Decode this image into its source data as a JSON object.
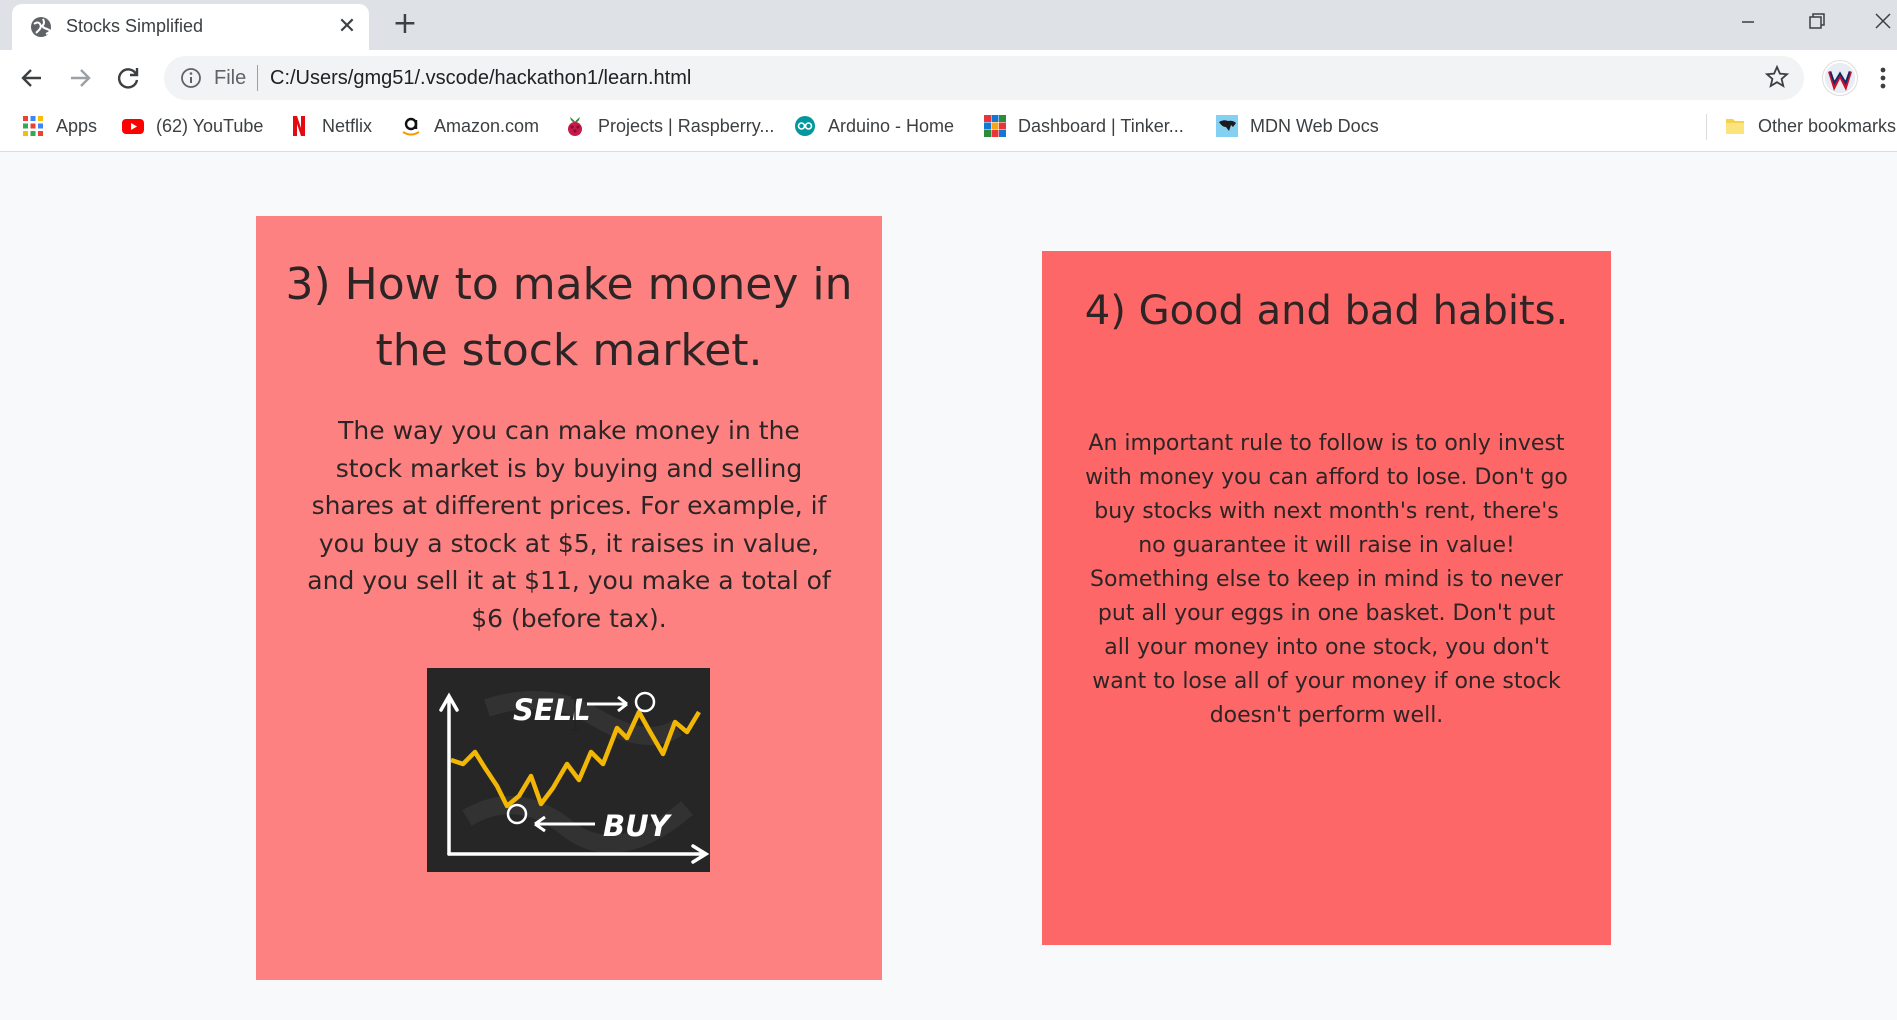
{
  "browser": {
    "tab_title": "Stocks Simplified",
    "tab_close": "✕",
    "new_tab": "+",
    "scheme": "File",
    "url": "C:/Users/gmg51/.vscode/hackathon1/learn.html"
  },
  "bookmarks": [
    {
      "label": "Apps",
      "icon": "apps-grid-icon"
    },
    {
      "label": "(62) YouTube",
      "icon": "youtube-icon"
    },
    {
      "label": "Netflix",
      "icon": "netflix-icon"
    },
    {
      "label": "Amazon.com",
      "icon": "amazon-icon"
    },
    {
      "label": "Projects | Raspberry...",
      "icon": "raspberry-icon"
    },
    {
      "label": "Arduino - Home",
      "icon": "arduino-icon"
    },
    {
      "label": "Dashboard | Tinker...",
      "icon": "tinkercad-icon"
    },
    {
      "label": "MDN Web Docs",
      "icon": "mdn-icon"
    },
    {
      "label": "Other bookmarks",
      "icon": "folder-icon"
    }
  ],
  "cards": {
    "left": {
      "title": "3) How to make money in the stock market.",
      "body": "The way you can make money in the stock market is by buying and selling shares at different prices. For example, if you buy a stock at $5, it raises in value, and you sell it at $11, you make a total of $6 (before tax).",
      "image": {
        "sell_label": "SELL",
        "buy_label": "BUY"
      }
    },
    "right": {
      "title": "4) Good and bad habits.",
      "paragraph_1": "An important rule to follow is to only invest with money you can afford to lose. Don't go buy stocks with next month's rent, there's no guarantee it will raise in value!",
      "paragraph_2": "Something else to keep in mind is to never put all your eggs in one basket. Don't put all your money into one stock, you don't want to lose all of your money if one stock doesn't perform well."
    }
  },
  "colors": {
    "card_left": "#fe8181",
    "card_right": "#fe6767",
    "text": "#2d2525",
    "chart_line": "#f2b705"
  }
}
